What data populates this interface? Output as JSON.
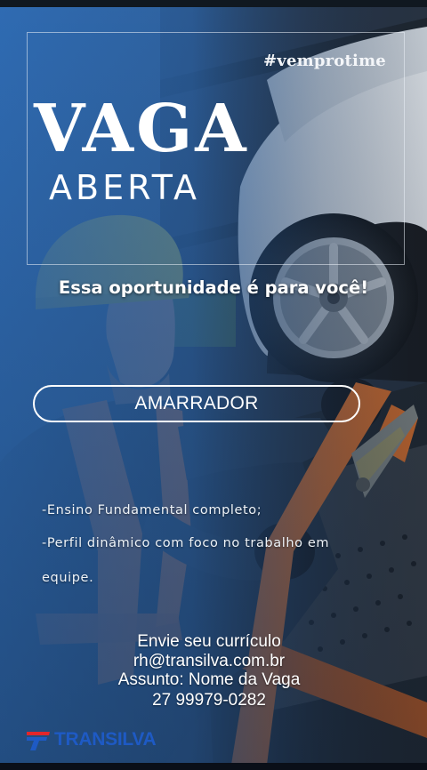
{
  "hashtag": "#vemprotime",
  "title_main": "VAGA",
  "title_sub": "ABERTA",
  "headline": "Essa oportunidade é para você!",
  "position": "AMARRADOR",
  "requirements": [
    "-Ensino Fundamental completo;",
    "-Perfil dinâmico com foco no trabalho em",
    "equipe."
  ],
  "contact": {
    "line1": "Envie seu currículo",
    "email": "rh@transilva.com.br",
    "subject": "Assunto: Nome da Vaga",
    "phone": "27 99979-0282"
  },
  "brand": {
    "name": "TRANSILVA",
    "primary_color": "#1e5ac4",
    "accent_color": "#e2262b"
  },
  "colors": {
    "overlay_blue": "#2f6fb8",
    "vest_orange": "#e8722a",
    "helmet_yellow": "#e2cc2a"
  }
}
